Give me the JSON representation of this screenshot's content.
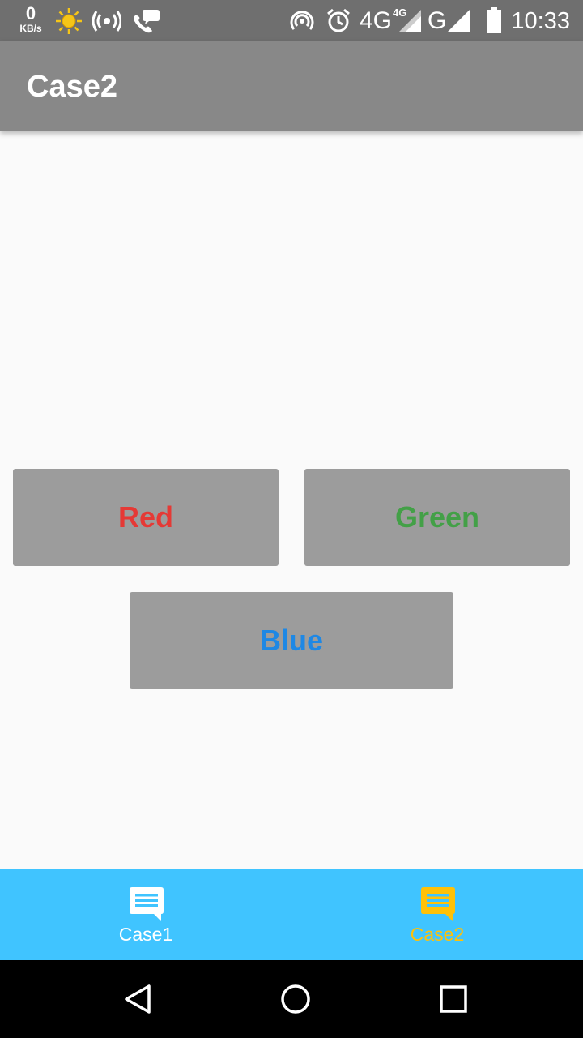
{
  "status_bar": {
    "speed_value": "0",
    "speed_unit": "KB/s",
    "network_4g": "4G",
    "network_4g_small": "4G",
    "network_g": "G",
    "time": "10:33"
  },
  "app_bar": {
    "title": "Case2"
  },
  "buttons": {
    "red_label": "Red",
    "green_label": "Green",
    "blue_label": "Blue",
    "red_color": "#e53935",
    "green_color": "#43a047",
    "blue_color": "#1e88e5"
  },
  "bottom_nav": {
    "items": [
      {
        "label": "Case1",
        "icon": "chat-icon",
        "color": "#ffffff",
        "selected": false
      },
      {
        "label": "Case2",
        "icon": "chat-icon",
        "color": "#ffc107",
        "selected": true
      }
    ]
  },
  "system_nav": {
    "icons": [
      "back-icon",
      "home-icon",
      "recents-icon"
    ]
  }
}
